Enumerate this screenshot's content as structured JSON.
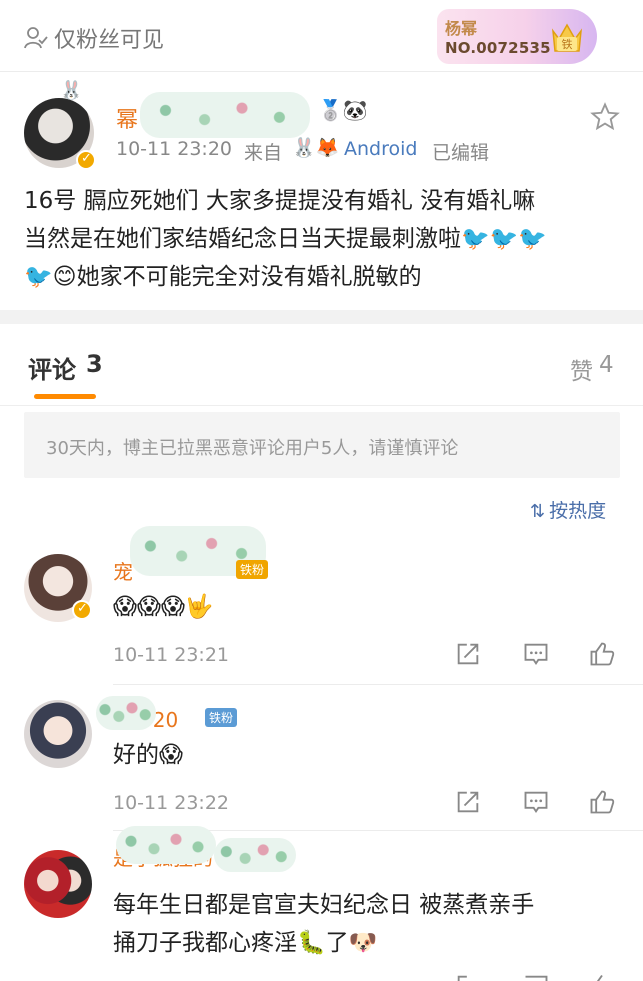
{
  "visibility": {
    "label": "仅粉丝可见",
    "icon": "fans-only-icon"
  },
  "fan_card": {
    "name": "杨幂",
    "number": "NO.0072535",
    "medal_text": "铁"
  },
  "post": {
    "user_name": "幂",
    "time": "10-11 23:20",
    "source_label": "来自",
    "source": "Android",
    "edited": "已编辑",
    "content_line1": "16号 膈应死她们 大家多提提没有婚礼  没有婚礼嘛",
    "content_line2": "当然是在她们家结婚纪念日当天提最刺激啦",
    "content_line3": "她家不可能完全对没有婚礼脱敏的",
    "accent": "#e8761d"
  },
  "tabs": {
    "comments_label": "评论",
    "comments_count": "3",
    "likes_label": "赞",
    "likes_count": "4"
  },
  "notice": "30天内，博主已拉黑恶意评论用户5人，请谨慎评论",
  "sort": {
    "icon": "sort-icon",
    "label": "按热度"
  },
  "comments": [
    {
      "name": "宠",
      "badge": "铁粉",
      "text": "😱😱😱🤟",
      "time": "10-11 23:21"
    },
    {
      "name": "幂520",
      "badge": "铁粉",
      "text": "好的😱",
      "time": "10-11 23:22"
    },
    {
      "name": "是小狐狸的",
      "text_line1": "每年生日都是官宣夫妇纪念日 被蒸煮亲手",
      "text_line2": "捅刀子我都心疼淫🐛了🐶"
    }
  ]
}
